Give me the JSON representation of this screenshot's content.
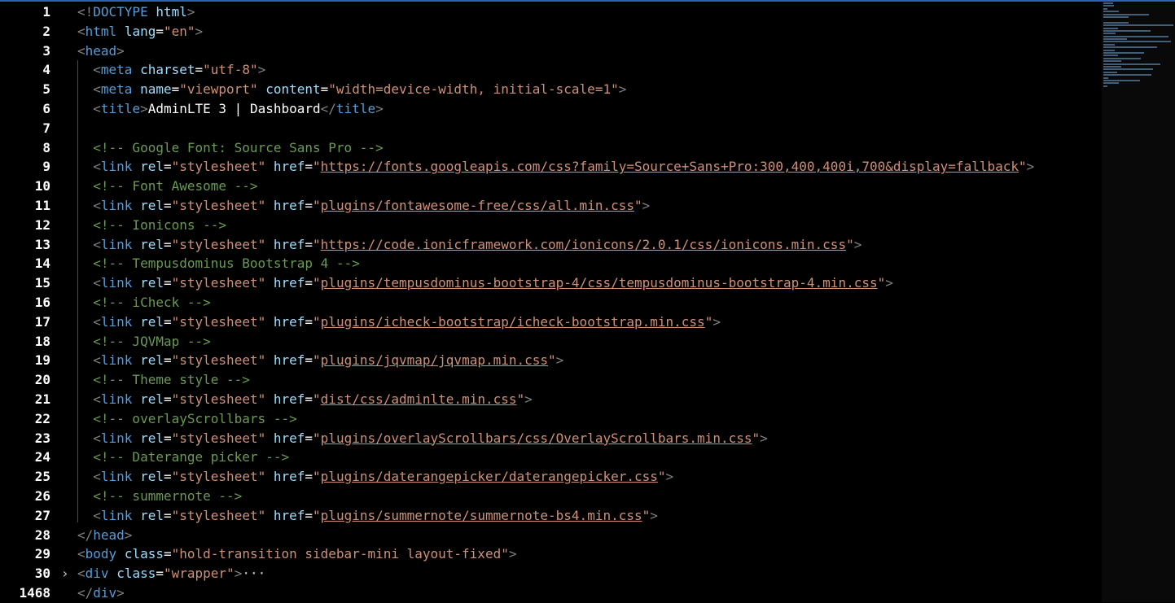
{
  "editor": {
    "accent_color": "#2b63b8",
    "background": "#000000",
    "language": "html",
    "lines": [
      {
        "num": "1",
        "tokens": [
          [
            "punct",
            "<!"
          ],
          [
            "tag",
            "DOCTYPE"
          ],
          [
            "text",
            " "
          ],
          [
            "attr",
            "html"
          ],
          [
            "punct",
            ">"
          ]
        ]
      },
      {
        "num": "2",
        "tokens": [
          [
            "punct",
            "<"
          ],
          [
            "tag",
            "html"
          ],
          [
            "text",
            " "
          ],
          [
            "attr",
            "lang"
          ],
          [
            "text",
            "="
          ],
          [
            "str",
            "\"en\""
          ],
          [
            "punct",
            ">"
          ]
        ]
      },
      {
        "num": "3",
        "tokens": [
          [
            "punct",
            "<"
          ],
          [
            "tag",
            "head"
          ],
          [
            "punct",
            ">"
          ]
        ]
      },
      {
        "num": "4",
        "tokens": [
          [
            "text",
            "  "
          ],
          [
            "punct",
            "<"
          ],
          [
            "tag",
            "meta"
          ],
          [
            "text",
            " "
          ],
          [
            "attr",
            "charset"
          ],
          [
            "text",
            "="
          ],
          [
            "str",
            "\"utf-8\""
          ],
          [
            "punct",
            ">"
          ]
        ]
      },
      {
        "num": "5",
        "tokens": [
          [
            "text",
            "  "
          ],
          [
            "punct",
            "<"
          ],
          [
            "tag",
            "meta"
          ],
          [
            "text",
            " "
          ],
          [
            "attr",
            "name"
          ],
          [
            "text",
            "="
          ],
          [
            "str",
            "\"viewport\""
          ],
          [
            "text",
            " "
          ],
          [
            "attr",
            "content"
          ],
          [
            "text",
            "="
          ],
          [
            "str",
            "\"width=device-width, initial-scale=1\""
          ],
          [
            "punct",
            ">"
          ]
        ]
      },
      {
        "num": "6",
        "tokens": [
          [
            "text",
            "  "
          ],
          [
            "punct",
            "<"
          ],
          [
            "tag",
            "title"
          ],
          [
            "punct",
            ">"
          ],
          [
            "text",
            "AdminLTE 3 | Dashboard"
          ],
          [
            "punct",
            "</"
          ],
          [
            "tag",
            "title"
          ],
          [
            "punct",
            ">"
          ]
        ]
      },
      {
        "num": "7",
        "tokens": []
      },
      {
        "num": "8",
        "tokens": [
          [
            "text",
            "  "
          ],
          [
            "com",
            "<!-- Google Font: Source Sans Pro -->"
          ]
        ]
      },
      {
        "num": "9",
        "tokens": [
          [
            "text",
            "  "
          ],
          [
            "punct",
            "<"
          ],
          [
            "tag",
            "link"
          ],
          [
            "text",
            " "
          ],
          [
            "attr",
            "rel"
          ],
          [
            "text",
            "="
          ],
          [
            "str",
            "\"stylesheet\""
          ],
          [
            "text",
            " "
          ],
          [
            "attr",
            "href"
          ],
          [
            "text",
            "="
          ],
          [
            "str",
            "\""
          ],
          [
            "link",
            "https://fonts.googleapis.com/css?family=Source+Sans+Pro:300,400,400i,700&display=fallback"
          ],
          [
            "str",
            "\""
          ],
          [
            "punct",
            ">"
          ]
        ]
      },
      {
        "num": "10",
        "tokens": [
          [
            "text",
            "  "
          ],
          [
            "com",
            "<!-- Font Awesome -->"
          ]
        ]
      },
      {
        "num": "11",
        "tokens": [
          [
            "text",
            "  "
          ],
          [
            "punct",
            "<"
          ],
          [
            "tag",
            "link"
          ],
          [
            "text",
            " "
          ],
          [
            "attr",
            "rel"
          ],
          [
            "text",
            "="
          ],
          [
            "str",
            "\"stylesheet\""
          ],
          [
            "text",
            " "
          ],
          [
            "attr",
            "href"
          ],
          [
            "text",
            "="
          ],
          [
            "str",
            "\""
          ],
          [
            "link",
            "plugins/fontawesome-free/css/all.min.css"
          ],
          [
            "str",
            "\""
          ],
          [
            "punct",
            ">"
          ]
        ]
      },
      {
        "num": "12",
        "tokens": [
          [
            "text",
            "  "
          ],
          [
            "com",
            "<!-- Ionicons -->"
          ]
        ]
      },
      {
        "num": "13",
        "tokens": [
          [
            "text",
            "  "
          ],
          [
            "punct",
            "<"
          ],
          [
            "tag",
            "link"
          ],
          [
            "text",
            " "
          ],
          [
            "attr",
            "rel"
          ],
          [
            "text",
            "="
          ],
          [
            "str",
            "\"stylesheet\""
          ],
          [
            "text",
            " "
          ],
          [
            "attr",
            "href"
          ],
          [
            "text",
            "="
          ],
          [
            "str",
            "\""
          ],
          [
            "link",
            "https://code.ionicframework.com/ionicons/2.0.1/css/ionicons.min.css"
          ],
          [
            "str",
            "\""
          ],
          [
            "punct",
            ">"
          ]
        ]
      },
      {
        "num": "14",
        "tokens": [
          [
            "text",
            "  "
          ],
          [
            "com",
            "<!-- Tempusdominus Bootstrap 4 -->"
          ]
        ]
      },
      {
        "num": "15",
        "tokens": [
          [
            "text",
            "  "
          ],
          [
            "punct",
            "<"
          ],
          [
            "tag",
            "link"
          ],
          [
            "text",
            " "
          ],
          [
            "attr",
            "rel"
          ],
          [
            "text",
            "="
          ],
          [
            "str",
            "\"stylesheet\""
          ],
          [
            "text",
            " "
          ],
          [
            "attr",
            "href"
          ],
          [
            "text",
            "="
          ],
          [
            "str",
            "\""
          ],
          [
            "link",
            "plugins/tempusdominus-bootstrap-4/css/tempusdominus-bootstrap-4.min.css"
          ],
          [
            "str",
            "\""
          ],
          [
            "punct",
            ">"
          ]
        ]
      },
      {
        "num": "16",
        "tokens": [
          [
            "text",
            "  "
          ],
          [
            "com",
            "<!-- iCheck -->"
          ]
        ]
      },
      {
        "num": "17",
        "tokens": [
          [
            "text",
            "  "
          ],
          [
            "punct",
            "<"
          ],
          [
            "tag",
            "link"
          ],
          [
            "text",
            " "
          ],
          [
            "attr",
            "rel"
          ],
          [
            "text",
            "="
          ],
          [
            "str",
            "\"stylesheet\""
          ],
          [
            "text",
            " "
          ],
          [
            "attr",
            "href"
          ],
          [
            "text",
            "="
          ],
          [
            "str",
            "\""
          ],
          [
            "link",
            "plugins/icheck-bootstrap/icheck-bootstrap.min.css"
          ],
          [
            "str",
            "\""
          ],
          [
            "punct",
            ">"
          ]
        ]
      },
      {
        "num": "18",
        "tokens": [
          [
            "text",
            "  "
          ],
          [
            "com",
            "<!-- JQVMap -->"
          ]
        ]
      },
      {
        "num": "19",
        "tokens": [
          [
            "text",
            "  "
          ],
          [
            "punct",
            "<"
          ],
          [
            "tag",
            "link"
          ],
          [
            "text",
            " "
          ],
          [
            "attr",
            "rel"
          ],
          [
            "text",
            "="
          ],
          [
            "str",
            "\"stylesheet\""
          ],
          [
            "text",
            " "
          ],
          [
            "attr",
            "href"
          ],
          [
            "text",
            "="
          ],
          [
            "str",
            "\""
          ],
          [
            "link",
            "plugins/jqvmap/jqvmap.min.css"
          ],
          [
            "str",
            "\""
          ],
          [
            "punct",
            ">"
          ]
        ]
      },
      {
        "num": "20",
        "tokens": [
          [
            "text",
            "  "
          ],
          [
            "com",
            "<!-- Theme style -->"
          ]
        ]
      },
      {
        "num": "21",
        "tokens": [
          [
            "text",
            "  "
          ],
          [
            "punct",
            "<"
          ],
          [
            "tag",
            "link"
          ],
          [
            "text",
            " "
          ],
          [
            "attr",
            "rel"
          ],
          [
            "text",
            "="
          ],
          [
            "str",
            "\"stylesheet\""
          ],
          [
            "text",
            " "
          ],
          [
            "attr",
            "href"
          ],
          [
            "text",
            "="
          ],
          [
            "str",
            "\""
          ],
          [
            "link",
            "dist/css/adminlte.min.css"
          ],
          [
            "str",
            "\""
          ],
          [
            "punct",
            ">"
          ]
        ]
      },
      {
        "num": "22",
        "tokens": [
          [
            "text",
            "  "
          ],
          [
            "com",
            "<!-- overlayScrollbars -->"
          ]
        ]
      },
      {
        "num": "23",
        "tokens": [
          [
            "text",
            "  "
          ],
          [
            "punct",
            "<"
          ],
          [
            "tag",
            "link"
          ],
          [
            "text",
            " "
          ],
          [
            "attr",
            "rel"
          ],
          [
            "text",
            "="
          ],
          [
            "str",
            "\"stylesheet\""
          ],
          [
            "text",
            " "
          ],
          [
            "attr",
            "href"
          ],
          [
            "text",
            "="
          ],
          [
            "str",
            "\""
          ],
          [
            "link",
            "plugins/overlayScrollbars/css/OverlayScrollbars.min.css"
          ],
          [
            "str",
            "\""
          ],
          [
            "punct",
            ">"
          ]
        ]
      },
      {
        "num": "24",
        "tokens": [
          [
            "text",
            "  "
          ],
          [
            "com",
            "<!-- Daterange picker -->"
          ]
        ]
      },
      {
        "num": "25",
        "tokens": [
          [
            "text",
            "  "
          ],
          [
            "punct",
            "<"
          ],
          [
            "tag",
            "link"
          ],
          [
            "text",
            " "
          ],
          [
            "attr",
            "rel"
          ],
          [
            "text",
            "="
          ],
          [
            "str",
            "\"stylesheet\""
          ],
          [
            "text",
            " "
          ],
          [
            "attr",
            "href"
          ],
          [
            "text",
            "="
          ],
          [
            "str",
            "\""
          ],
          [
            "link",
            "plugins/daterangepicker/daterangepicker.css"
          ],
          [
            "str",
            "\""
          ],
          [
            "punct",
            ">"
          ]
        ]
      },
      {
        "num": "26",
        "tokens": [
          [
            "text",
            "  "
          ],
          [
            "com",
            "<!-- summernote -->"
          ]
        ]
      },
      {
        "num": "27",
        "tokens": [
          [
            "text",
            "  "
          ],
          [
            "punct",
            "<"
          ],
          [
            "tag",
            "link"
          ],
          [
            "text",
            " "
          ],
          [
            "attr",
            "rel"
          ],
          [
            "text",
            "="
          ],
          [
            "str",
            "\"stylesheet\""
          ],
          [
            "text",
            " "
          ],
          [
            "attr",
            "href"
          ],
          [
            "text",
            "="
          ],
          [
            "str",
            "\""
          ],
          [
            "link",
            "plugins/summernote/summernote-bs4.min.css"
          ],
          [
            "str",
            "\""
          ],
          [
            "punct",
            ">"
          ]
        ]
      },
      {
        "num": "28",
        "tokens": [
          [
            "punct",
            "</"
          ],
          [
            "tag",
            "head"
          ],
          [
            "punct",
            ">"
          ]
        ]
      },
      {
        "num": "29",
        "tokens": [
          [
            "punct",
            "<"
          ],
          [
            "tag",
            "body"
          ],
          [
            "text",
            " "
          ],
          [
            "attr",
            "class"
          ],
          [
            "text",
            "="
          ],
          [
            "str",
            "\"hold-transition sidebar-mini layout-fixed\""
          ],
          [
            "punct",
            ">"
          ]
        ]
      },
      {
        "num": "30",
        "fold": "›",
        "tokens": [
          [
            "punct",
            "<"
          ],
          [
            "tag",
            "div"
          ],
          [
            "text",
            " "
          ],
          [
            "attr",
            "class"
          ],
          [
            "text",
            "="
          ],
          [
            "str",
            "\"wrapper\""
          ],
          [
            "punct",
            ">"
          ],
          [
            "ellipsis",
            "···"
          ]
        ]
      },
      {
        "num": "1468",
        "tokens": [
          [
            "punct",
            "</"
          ],
          [
            "tag",
            "div"
          ],
          [
            "punct",
            ">"
          ]
        ]
      }
    ]
  }
}
